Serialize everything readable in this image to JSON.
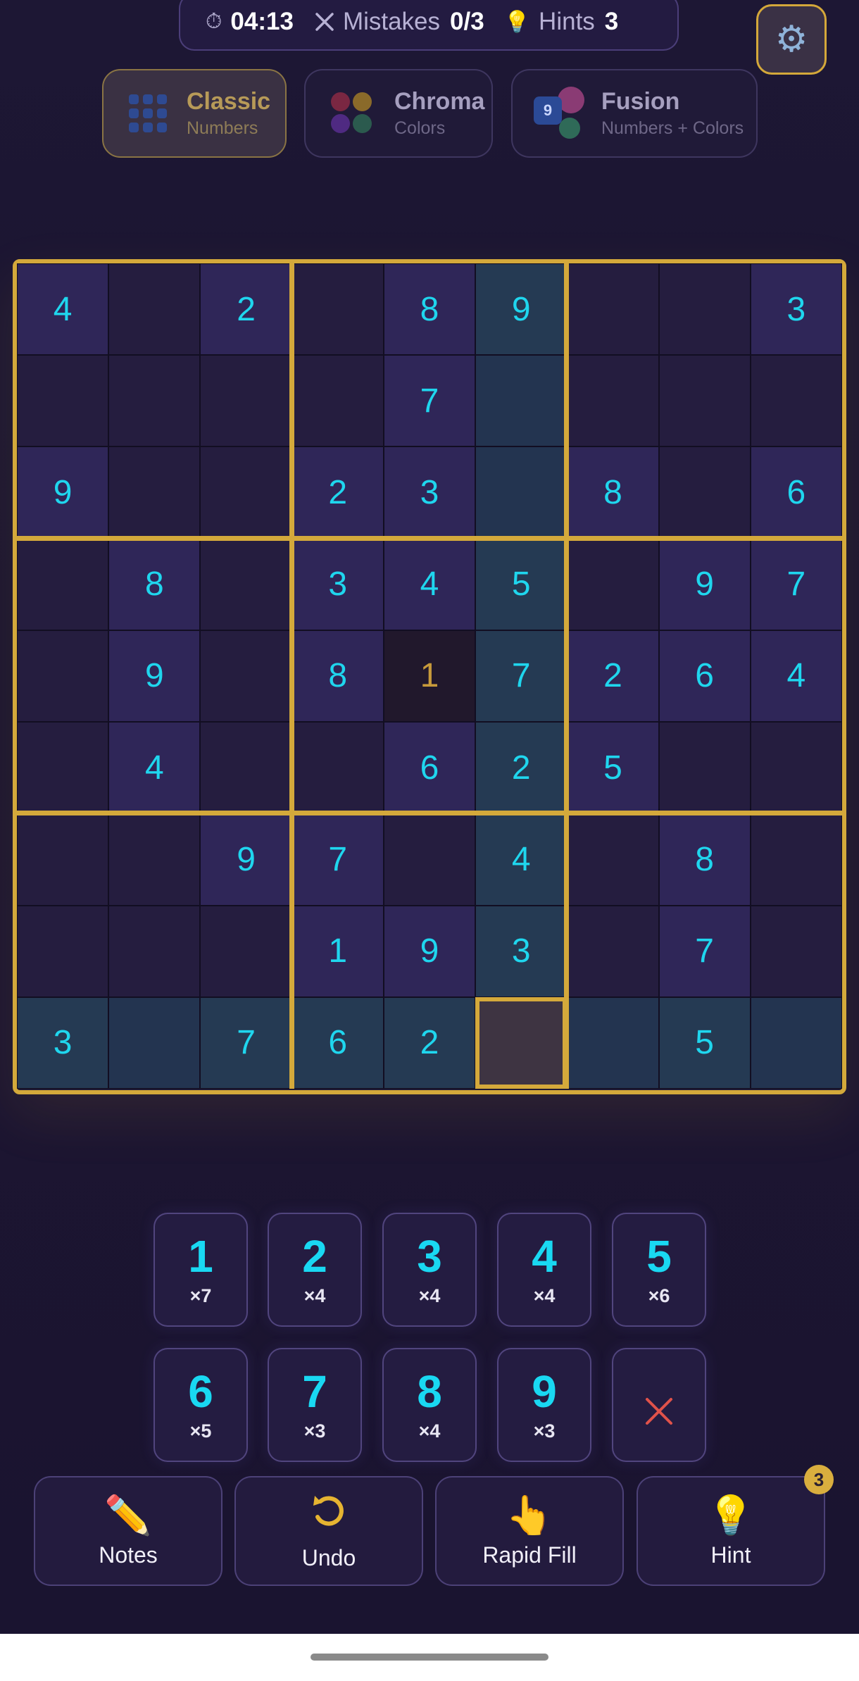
{
  "status": {
    "timer_icon": "stopwatch-icon",
    "timer": "04:13",
    "mistakes_icon": "x-icon",
    "mistakes_label": "Mistakes",
    "mistakes_value": "0/3",
    "hints_icon": "lightbulb-icon",
    "hints_label": "Hints",
    "hints_value": "3"
  },
  "settings_icon": "gear-icon",
  "modes": [
    {
      "name": "Classic",
      "sub": "Numbers",
      "active": true
    },
    {
      "name": "Chroma",
      "sub": "Colors",
      "active": false
    },
    {
      "name": "Fusion",
      "sub": "Numbers + Colors",
      "active": false,
      "icon_number": "9"
    }
  ],
  "board": {
    "rows": [
      [
        "4",
        "",
        "2",
        "",
        "8",
        "9",
        "",
        "",
        "3"
      ],
      [
        "",
        "",
        "",
        "",
        "7",
        "",
        "",
        "",
        ""
      ],
      [
        "9",
        "",
        "",
        "2",
        "3",
        "",
        "8",
        "",
        "6"
      ],
      [
        "",
        "8",
        "",
        "3",
        "4",
        "5",
        "",
        "9",
        "7"
      ],
      [
        "",
        "9",
        "",
        "8",
        "1",
        "7",
        "2",
        "6",
        "4"
      ],
      [
        "",
        "4",
        "",
        "",
        "6",
        "2",
        "5",
        "",
        ""
      ],
      [
        "",
        "",
        "9",
        "7",
        "",
        "4",
        "",
        "8",
        ""
      ],
      [
        "",
        "",
        "",
        "1",
        "9",
        "3",
        "",
        "7",
        ""
      ],
      [
        "3",
        "",
        "7",
        "6",
        "2",
        "",
        "",
        "5",
        ""
      ]
    ],
    "selected_cell": {
      "row": 9,
      "col": 6
    },
    "highlighted_value_cell": {
      "row": 5,
      "col": 5,
      "value": "1"
    },
    "colors": {
      "highlight_value": "#c79a3b",
      "digit": "#1fd6ee",
      "grid_gold": "#d4a93b"
    }
  },
  "keypad": [
    {
      "num": "1",
      "count": "×7"
    },
    {
      "num": "2",
      "count": "×4"
    },
    {
      "num": "3",
      "count": "×4"
    },
    {
      "num": "4",
      "count": "×4"
    },
    {
      "num": "5",
      "count": "×6"
    },
    {
      "num": "6",
      "count": "×5"
    },
    {
      "num": "7",
      "count": "×3"
    },
    {
      "num": "8",
      "count": "×4"
    },
    {
      "num": "9",
      "count": "×3"
    }
  ],
  "erase_icon": "erase-x-icon",
  "actions": [
    {
      "label": "Notes",
      "icon": "pencil-icon"
    },
    {
      "label": "Undo",
      "icon": "undo-icon"
    },
    {
      "label": "Rapid Fill",
      "icon": "pointing-hand-icon"
    },
    {
      "label": "Hint",
      "icon": "lightbulb-icon"
    }
  ],
  "hint_badge": "3"
}
